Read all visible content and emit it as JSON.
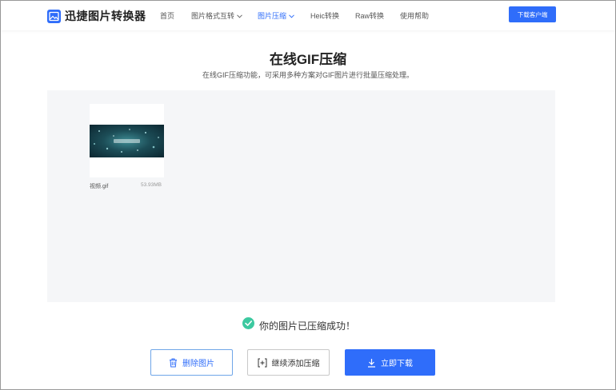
{
  "header": {
    "app_name": "迅捷图片转换器",
    "logo_icon": "image-logo-icon",
    "nav": [
      {
        "label": "首页",
        "active": false,
        "dropdown": false
      },
      {
        "label": "图片格式互转",
        "active": false,
        "dropdown": true
      },
      {
        "label": "图片压缩",
        "active": true,
        "dropdown": true
      },
      {
        "label": "Heic转换",
        "active": false,
        "dropdown": false
      },
      {
        "label": "Raw转换",
        "active": false,
        "dropdown": false
      },
      {
        "label": "使用帮助",
        "active": false,
        "dropdown": false
      }
    ],
    "download_client_label": "下载客户端"
  },
  "page": {
    "title": "在线GIF压缩",
    "subtitle": "在线GIF压缩功能，可采用多种方案对GIF图片进行批量压缩处理。"
  },
  "files": [
    {
      "name": "视频.gif",
      "size": "53.93MB"
    }
  ],
  "status": {
    "message": "你的图片已压缩成功！",
    "icon": "check-circle-icon"
  },
  "actions": {
    "delete_label": "删除图片",
    "add_more_label": "继续添加压缩",
    "download_label": "立即下载"
  },
  "colors": {
    "accent": "#2f6dfa",
    "success": "#3cc9a0",
    "work_area_bg": "#f5f6f8"
  }
}
